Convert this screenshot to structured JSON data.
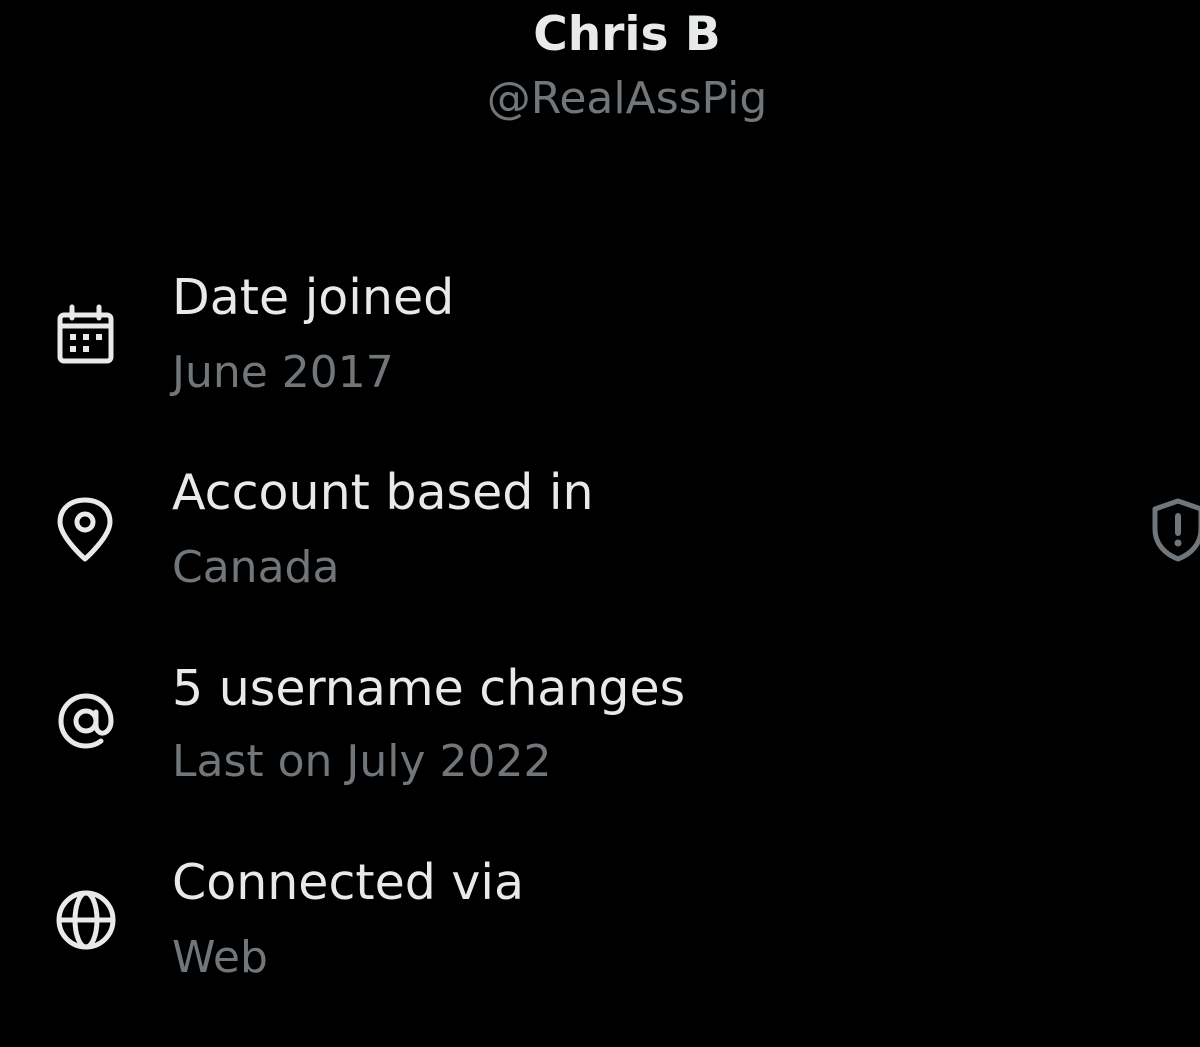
{
  "profile": {
    "display_name": "Chris B",
    "handle": "@RealAssPig"
  },
  "about": [
    {
      "icon": "calendar-icon",
      "title": "Date joined",
      "value": "June 2017"
    },
    {
      "icon": "location-pin-icon",
      "title": "Account based in",
      "value": "Canada"
    },
    {
      "icon": "at-sign-icon",
      "title": "5 username changes",
      "value": "Last on July 2022"
    },
    {
      "icon": "globe-icon",
      "title": "Connected via",
      "value": "Web"
    }
  ],
  "side_icon": "shield-alert-icon",
  "colors": {
    "background": "#000000",
    "primary_text": "#e7e9ea",
    "secondary_text": "#71767b"
  }
}
